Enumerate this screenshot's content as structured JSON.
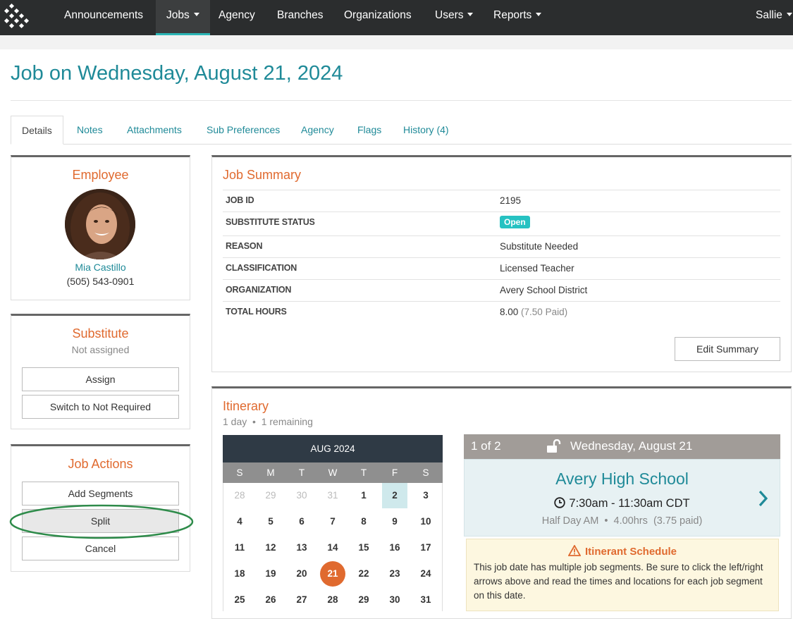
{
  "nav": {
    "items": [
      "Announcements",
      "Jobs",
      "Agency",
      "Branches",
      "Organizations",
      "Users",
      "Reports"
    ],
    "user": "Sallie"
  },
  "page": {
    "title": "Job on Wednesday, August 21, 2024"
  },
  "tabs": [
    "Details",
    "Notes",
    "Attachments",
    "Sub Preferences",
    "Agency",
    "Flags",
    "History (4)"
  ],
  "employee": {
    "heading": "Employee",
    "name": "Mia Castillo",
    "phone": "(505) 543-0901"
  },
  "substitute": {
    "heading": "Substitute",
    "status": "Not assigned",
    "assign_label": "Assign",
    "switch_label": "Switch to Not Required"
  },
  "job_actions": {
    "heading": "Job Actions",
    "add_segments": "Add Segments",
    "split": "Split",
    "cancel": "Cancel"
  },
  "summary": {
    "heading": "Job Summary",
    "rows": [
      {
        "label": "JOB ID",
        "value": "2195"
      },
      {
        "label": "SUBSTITUTE STATUS",
        "value": "Open"
      },
      {
        "label": "REASON",
        "value": "Substitute Needed"
      },
      {
        "label": "CLASSIFICATION",
        "value": "Licensed Teacher"
      },
      {
        "label": "ORGANIZATION",
        "value": "Avery School District"
      },
      {
        "label": "TOTAL HOURS",
        "value": "8.00",
        "extra": "(7.50 Paid)"
      }
    ],
    "edit_label": "Edit Summary"
  },
  "itinerary": {
    "heading": "Itinerary",
    "days": "1 day",
    "remaining": "1 remaining",
    "calendar": {
      "month": "AUG 2024",
      "dow": [
        "S",
        "M",
        "T",
        "W",
        "T",
        "F",
        "S"
      ],
      "weeks": [
        [
          "28",
          "29",
          "30",
          "31",
          "1",
          "2",
          "3"
        ],
        [
          "4",
          "5",
          "6",
          "7",
          "8",
          "9",
          "10"
        ],
        [
          "11",
          "12",
          "13",
          "14",
          "15",
          "16",
          "17"
        ],
        [
          "18",
          "19",
          "20",
          "21",
          "22",
          "23",
          "24"
        ],
        [
          "25",
          "26",
          "27",
          "28",
          "29",
          "30",
          "31"
        ]
      ],
      "highlighted": "2",
      "selected": "21"
    },
    "segment": {
      "counter": "1 of 2",
      "date": "Wednesday, August 21",
      "school": "Avery High School",
      "time": "7:30am - 11:30am CDT",
      "type": "Half Day AM",
      "hours": "4.00hrs",
      "paid": "(3.75 paid)"
    },
    "warning": {
      "title": "Itinerant Schedule",
      "text": "This job date has multiple job segments. Be sure to click the left/right arrows above and read the times and locations for each job segment on this date."
    }
  }
}
